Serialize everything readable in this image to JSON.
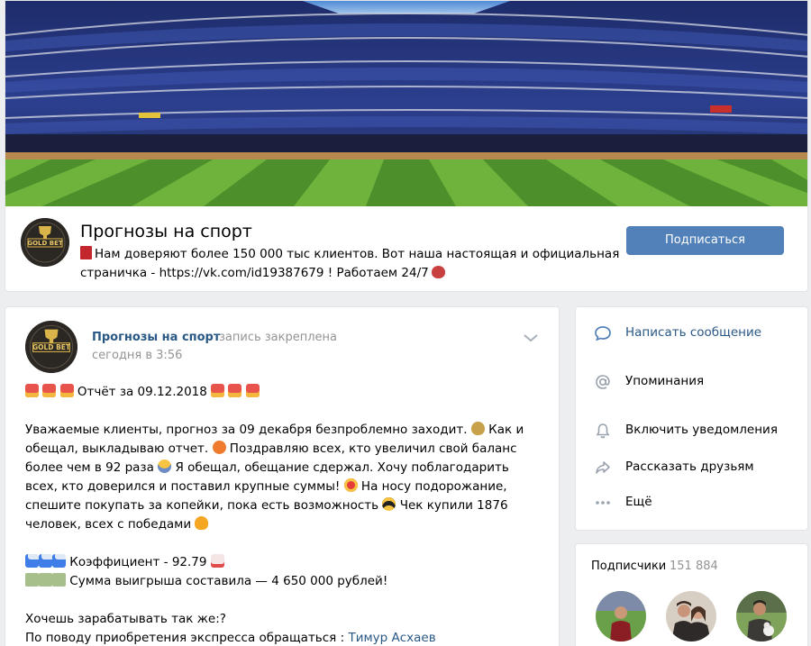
{
  "group": {
    "title": "Прогнозы на спорт",
    "status_text": "Нам доверяют более 150 000 тыс клиентов. Вот наша настоящая и официальная страничка - https://vk.com/id19387679 ! Работаем 24/7",
    "subscribe_label": "Подписаться",
    "avatar_logo_text": "GOLD BET"
  },
  "post": {
    "author": "Прогнозы на спорт",
    "pinned_note": "запись закреплена",
    "time": "сегодня в 3:56",
    "headline": "Отчёт за 09.12.2018",
    "paragraph": [
      "Уважаемые клиенты, прогноз за 09 декабря безпроблемно заходит.",
      "Как и обещал, выкладываю отчет.",
      "Поздравляю всех, кто увеличил свой баланс более чем в 92 раза",
      "Я обещал, обещание сдержал. Хочу поблагодарить всех, кто доверился и поставил крупные суммы!",
      "На носу подорожание, спешите покупать за копейки, пока есть возможность",
      "Чек купили 1876 человек, всех с победами"
    ],
    "coefficient": "Коэффициент - 92.79",
    "winnings": "Сумма выигрыша составила — 4 650 000 рублей!",
    "cta_question": "Хочешь зарабатывать так же:?",
    "contact_prefix": "По поводу приобретения экспресса обращаться :",
    "contact_name": "Тимур Асхаев"
  },
  "menu": {
    "items": [
      {
        "label": "Написать сообщение",
        "icon": "message-icon"
      },
      {
        "label": "Упоминания",
        "icon": "at-icon"
      },
      {
        "label": "Включить уведомления",
        "icon": "bell-icon"
      },
      {
        "label": "Рассказать друзьям",
        "icon": "share-icon"
      },
      {
        "label": "Ещё",
        "icon": "more-icon"
      }
    ]
  },
  "subscribers": {
    "title": "Подписчики",
    "count": "151 884"
  },
  "colors": {
    "accent": "#5181b8",
    "link": "#2a5885",
    "muted": "#939393",
    "background": "#edeef0"
  }
}
